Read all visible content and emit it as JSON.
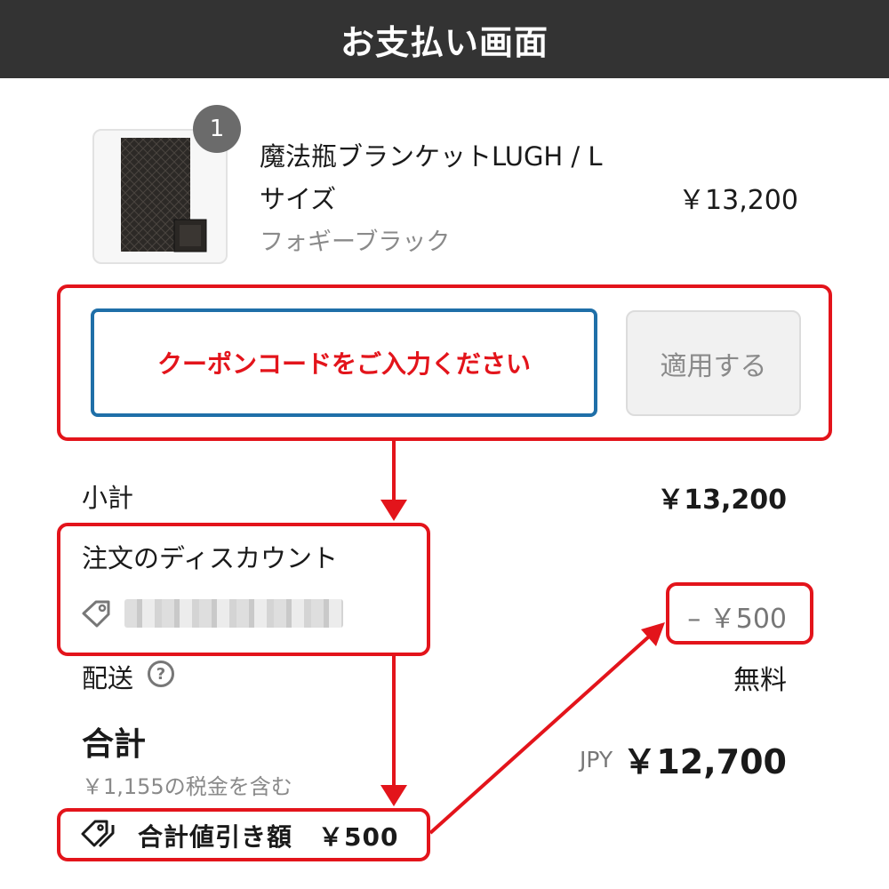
{
  "header": {
    "title": "お支払い画面"
  },
  "product": {
    "name": "魔法瓶ブランケットLUGH / L\nサイズ",
    "name_line1": "魔法瓶ブランケットLUGH / L",
    "name_line2": "サイズ",
    "variant": "フォギーブラック",
    "price": "￥13,200",
    "quantity": "1",
    "image_icon": "blanket-thumbnail"
  },
  "coupon": {
    "placeholder": "クーポンコードをご入力ください",
    "apply_label": "適用する"
  },
  "summary": {
    "subtotal_label": "小計",
    "subtotal_value": "￥13,200",
    "discount_label": "注文のディスカウント",
    "discount_value": "– ￥500",
    "shipping_label": "配送",
    "shipping_value": "無料",
    "total_label": "合計",
    "tax_note": "￥1,155の税金を含む",
    "currency": "JPY",
    "total_value": "￥12,700",
    "total_discount": "合計値引き額　￥500"
  },
  "colors": {
    "header_bg": "#333333",
    "annotation_red": "#e3141b",
    "input_border": "#1f6fa8"
  }
}
